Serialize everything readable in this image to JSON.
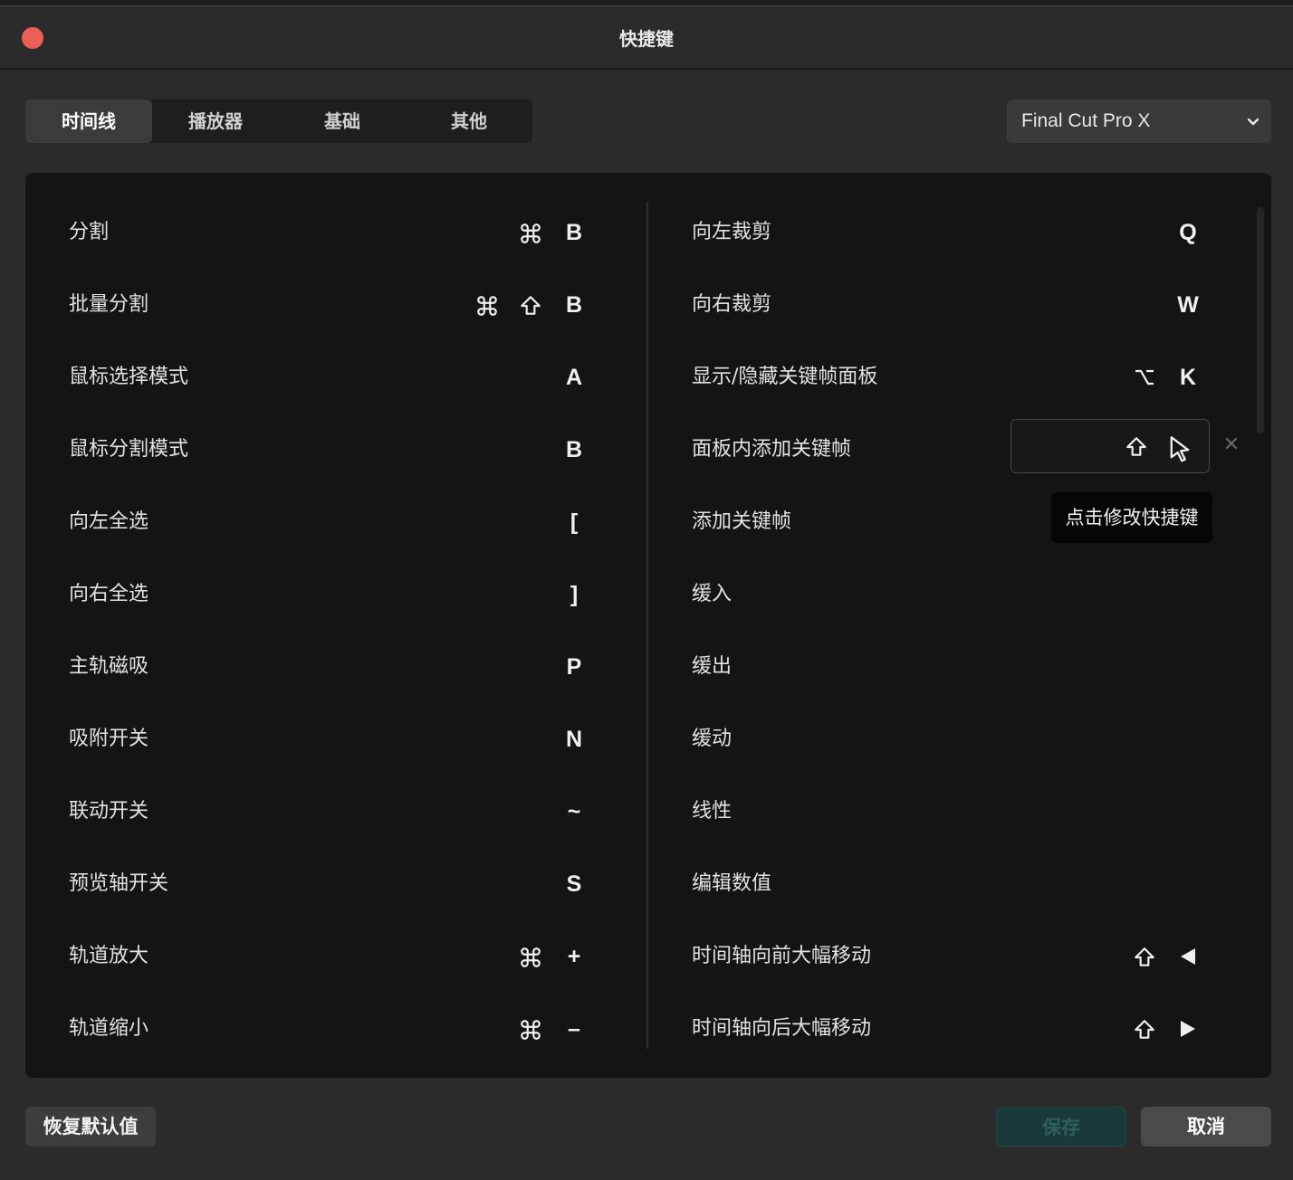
{
  "window": {
    "title": "快捷键"
  },
  "tabs": [
    {
      "label": "时间线",
      "active": true
    },
    {
      "label": "播放器",
      "active": false
    },
    {
      "label": "基础",
      "active": false
    },
    {
      "label": "其他",
      "active": false
    }
  ],
  "preset": {
    "selected": "Final Cut Pro X"
  },
  "left_column": [
    {
      "label": "分割",
      "keys": [
        "cmd",
        "B"
      ]
    },
    {
      "label": "批量分割",
      "keys": [
        "cmd",
        "shift",
        "B"
      ]
    },
    {
      "label": "鼠标选择模式",
      "keys": [
        "A"
      ]
    },
    {
      "label": "鼠标分割模式",
      "keys": [
        "B"
      ]
    },
    {
      "label": "向左全选",
      "keys": [
        "["
      ]
    },
    {
      "label": "向右全选",
      "keys": [
        "]"
      ]
    },
    {
      "label": "主轨磁吸",
      "keys": [
        "P"
      ]
    },
    {
      "label": "吸附开关",
      "keys": [
        "N"
      ]
    },
    {
      "label": "联动开关",
      "keys": [
        "~"
      ]
    },
    {
      "label": "预览轴开关",
      "keys": [
        "S"
      ]
    },
    {
      "label": "轨道放大",
      "keys": [
        "cmd",
        "+"
      ]
    },
    {
      "label": "轨道缩小",
      "keys": [
        "cmd",
        "–"
      ]
    }
  ],
  "right_column": [
    {
      "label": "向左裁剪",
      "keys": [
        "Q"
      ]
    },
    {
      "label": "向右裁剪",
      "keys": [
        "W"
      ]
    },
    {
      "label": "显示/隐藏关键帧面板",
      "keys": [
        "option",
        "K"
      ]
    },
    {
      "label": "面板内添加关键帧",
      "keys": [
        "shift",
        "mouse-click"
      ],
      "editing": true
    },
    {
      "label": "添加关键帧",
      "keys": []
    },
    {
      "label": "缓入",
      "keys": []
    },
    {
      "label": "缓出",
      "keys": []
    },
    {
      "label": "缓动",
      "keys": []
    },
    {
      "label": "线性",
      "keys": []
    },
    {
      "label": "编辑数值",
      "keys": []
    },
    {
      "label": "时间轴向前大幅移动",
      "keys": [
        "shift",
        "left-triangle"
      ]
    },
    {
      "label": "时间轴向后大幅移动",
      "keys": [
        "shift",
        "right-triangle"
      ]
    }
  ],
  "tooltip": "点击修改快捷键",
  "buttons": {
    "reset": "恢复默认值",
    "save": "保存",
    "cancel": "取消"
  },
  "colors": {
    "close": "#ec5f57",
    "save_disabled_bg": "#1a3a3a"
  }
}
